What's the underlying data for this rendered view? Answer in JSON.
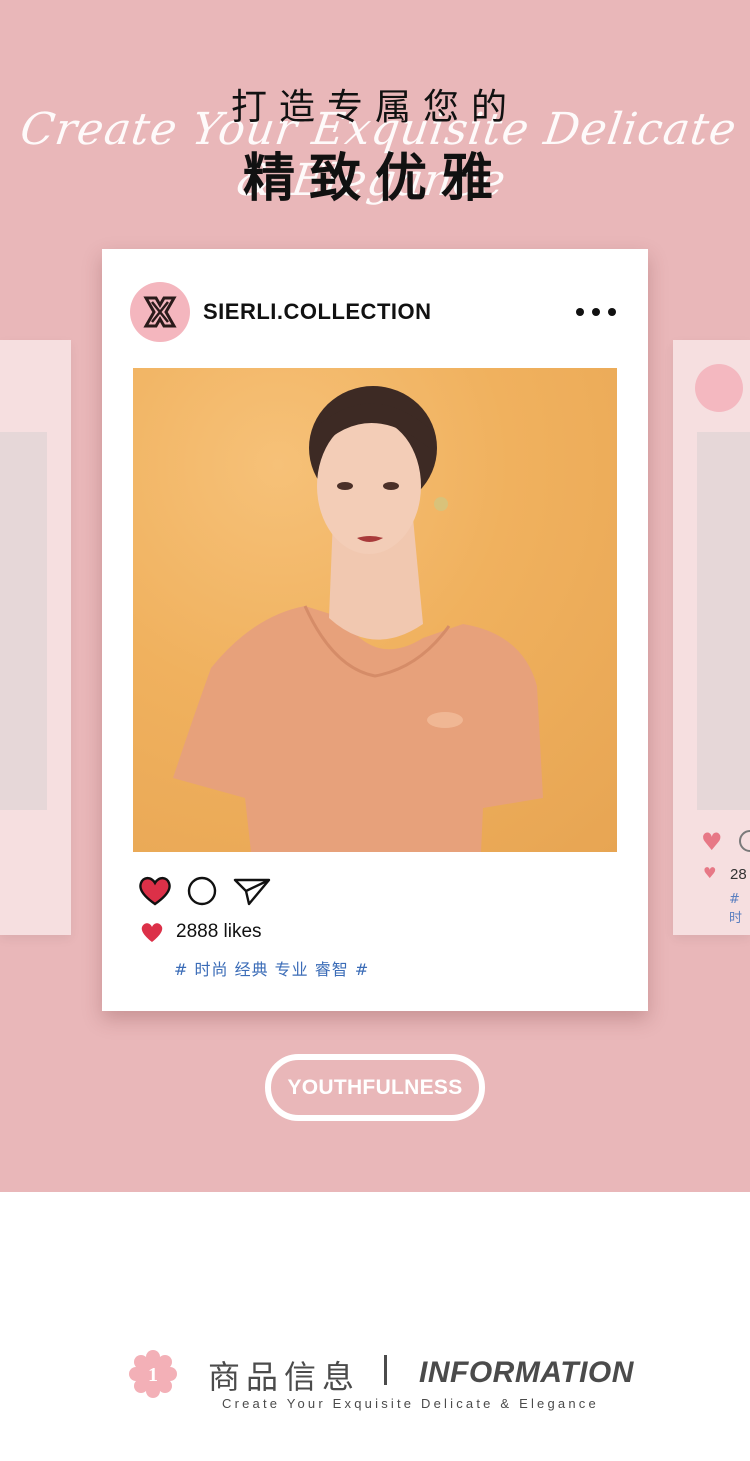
{
  "hero": {
    "headline_small": "打造专属您的",
    "headline_script": "Create Your Exquisite Delicate & Elegance",
    "headline_big": "精致优雅",
    "background_color": "#e9b7b9"
  },
  "post": {
    "username": "SIERLI.COLLECTION",
    "avatar_icon": "sierli-logo-icon",
    "more_icon": "more-dots-icon",
    "likes_count": "2888 likes",
    "tags": "# 时尚 经典 专业 睿智 #",
    "actions": [
      "heart-icon",
      "comment-icon",
      "send-icon"
    ],
    "accent_color": "#dc3048",
    "tag_color": "#3b6cb7"
  },
  "side_card_right": {
    "likes_count": "28",
    "tag": "# 时"
  },
  "cta": {
    "label": "YOUTHFULNESS"
  },
  "info": {
    "number": "1",
    "title_cn": "商品信息",
    "title_en": "INFORMATION",
    "subtitle": "Create Your Exquisite Delicate & Elegance"
  }
}
